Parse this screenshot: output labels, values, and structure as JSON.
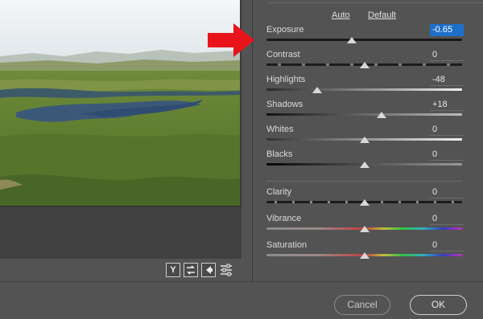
{
  "panel": {
    "auto_label": "Auto",
    "default_label": "Default",
    "basic_sliders": [
      {
        "label": "Exposure",
        "value": "-0.65",
        "numeric": -0.65,
        "min": -5,
        "max": 5,
        "track": "dark",
        "focused": true
      },
      {
        "label": "Contrast",
        "value": "0",
        "numeric": 0,
        "min": -100,
        "max": 100,
        "track": "contrast",
        "focused": false
      },
      {
        "label": "Highlights",
        "value": "-48",
        "numeric": -48,
        "min": -100,
        "max": 100,
        "track": "highlights",
        "focused": false
      },
      {
        "label": "Shadows",
        "value": "+18",
        "numeric": 18,
        "min": -100,
        "max": 100,
        "track": "shadows",
        "focused": false
      },
      {
        "label": "Whites",
        "value": "0",
        "numeric": 0,
        "min": -100,
        "max": 100,
        "track": "whites",
        "focused": false
      },
      {
        "label": "Blacks",
        "value": "0",
        "numeric": 0,
        "min": -100,
        "max": 100,
        "track": "blacks",
        "focused": false
      }
    ],
    "presence_sliders": [
      {
        "label": "Clarity",
        "value": "0",
        "numeric": 0,
        "min": -100,
        "max": 100,
        "track": "clarity",
        "focused": false
      },
      {
        "label": "Vibrance",
        "value": "0",
        "numeric": 0,
        "min": -100,
        "max": 100,
        "track": "rainbow",
        "focused": false
      },
      {
        "label": "Saturation",
        "value": "0",
        "numeric": 0,
        "min": -100,
        "max": 100,
        "track": "rainbow",
        "focused": false
      }
    ]
  },
  "toolbar": {
    "y_label": "Y",
    "icons": [
      "swap-before-after-icon",
      "copy-settings-icon",
      "preferences-sliders-icon"
    ]
  },
  "dialog": {
    "cancel_label": "Cancel",
    "ok_label": "OK"
  },
  "colors": {
    "focus_blue": "#1e6fc9",
    "annotation_red": "#e8141a",
    "panel_bg": "#535353"
  }
}
